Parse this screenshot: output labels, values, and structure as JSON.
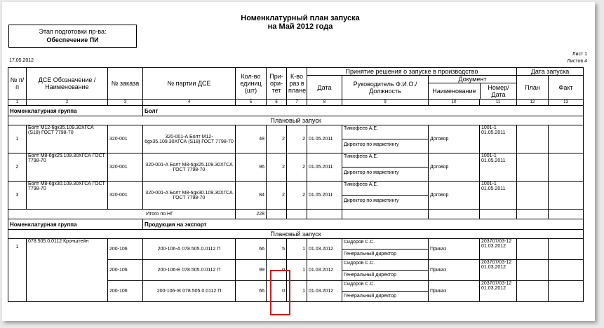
{
  "doc": {
    "title_line1": "Номенклатурный план запуска",
    "title_line2": "на Май 2012 года",
    "stage_label": "Этап подготовки пр-ва:",
    "stage_value": "Обеспечение ПИ",
    "date": "17.05.2012",
    "sheet": "Лист 1",
    "sheets": "Листов 4"
  },
  "headers": {
    "npp": "№ п/п",
    "dse": "ДСЕ Обозначение / Наименование",
    "order": "№ заказа",
    "batch": "№ партии ДСЕ",
    "qty": "Кол-во единиц (шт)",
    "priority": "При-ори-тет",
    "times": "К-во раз в плане",
    "decision": "Принятие решения о запуске в производство",
    "launch_date": "Дата запуска",
    "date": "Дата",
    "head": "Руководитель Ф.И.О./ Должность",
    "document": "Документ",
    "doc_name": "Наименование",
    "doc_num": "Номер/ Дата",
    "plan": "План",
    "fact": "Факт",
    "colnums": [
      "1",
      "2",
      "3",
      "4",
      "5",
      "6",
      "7",
      "8",
      "9",
      "10",
      "11",
      "12",
      "13"
    ]
  },
  "groups": [
    {
      "label": "Номенклатурная группа",
      "name": "Болт",
      "section": "Плановый запуск",
      "rows": [
        {
          "n": "1",
          "dse": "Болт М12-6gx35.109.30ХГСА (S18) ГОСТ 7798-70",
          "order": "320-001",
          "batch": "320-001-А Болт М12-6gx35.109.30ХГСА (S18) ГОСТ 7798-70",
          "qty": "48",
          "prio": "2",
          "times": "2",
          "date": "01.05.2011",
          "person": "Тимофеев А.Е.",
          "position": "Директор по маркетингу",
          "doc": "Договор",
          "docnum": "1001-1 01.05.2011"
        },
        {
          "n": "2",
          "dse": "Болт М8-6gx25.109.30ХГСА ГОСТ 7798-70",
          "order": "320-001",
          "batch": "320-001-А Болт М8-6gx25.109.30ХГСА ГОСТ 7798-70",
          "qty": "96",
          "prio": "2",
          "times": "2",
          "date": "01.05.2011",
          "person": "Тимофеев А.Е.",
          "position": "Директор по маркетингу",
          "doc": "Договор",
          "docnum": "1001-1 01.05.2011"
        },
        {
          "n": "3",
          "dse": "Болт М8-6gx30.109.30ХГСА ГОСТ 7798-70",
          "order": "320-001",
          "batch": "320-001-А Болт М8-6gx30.109.30ХГСА ГОСТ 7798-70",
          "qty": "84",
          "prio": "2",
          "times": "2",
          "date": "01.05.2011",
          "person": "Тимофеев А.Е.",
          "position": "Директор по маркетингу",
          "doc": "Договор",
          "docnum": "1001-1 01.05.2011"
        }
      ],
      "total_label": "Итого по НГ",
      "total": "228"
    },
    {
      "label": "Номенклатурная группа",
      "name": "Продукция на экспорт",
      "section": "Плановый запуск",
      "rows": [
        {
          "n": "1",
          "dse": "078.505.0.0112 Кронштейн",
          "order": "200-106",
          "batch": "200-106-А 078.505.0.0112 П",
          "qty": "66",
          "prio": "5",
          "times": "1",
          "date": "01.03.2012",
          "person": "Сидоров С.С.",
          "position": "Генеральный директор",
          "doc": "Приказ",
          "docnum": "203707/03-12 01.03.2012"
        },
        {
          "n": "",
          "dse": "",
          "order": "200-106",
          "batch": "200-106-Е 078.505.0.0112 П",
          "qty": "99",
          "prio": "0",
          "times": "1",
          "date": "01.03.2012",
          "person": "Сидоров С.С.",
          "position": "Генеральный директор",
          "doc": "Приказ",
          "docnum": "203707/03-12 01.03.2012"
        },
        {
          "n": "",
          "dse": "",
          "order": "200-106",
          "batch": "200-106-Ж 078.505.0.0112 П",
          "qty": "66",
          "prio": "0",
          "times": "1",
          "date": "01.03.2012",
          "person": "Сидоров С.С.",
          "position": "Генеральный директор",
          "doc": "Приказ",
          "docnum": "203707/03-12 01.03.2012"
        }
      ]
    }
  ]
}
